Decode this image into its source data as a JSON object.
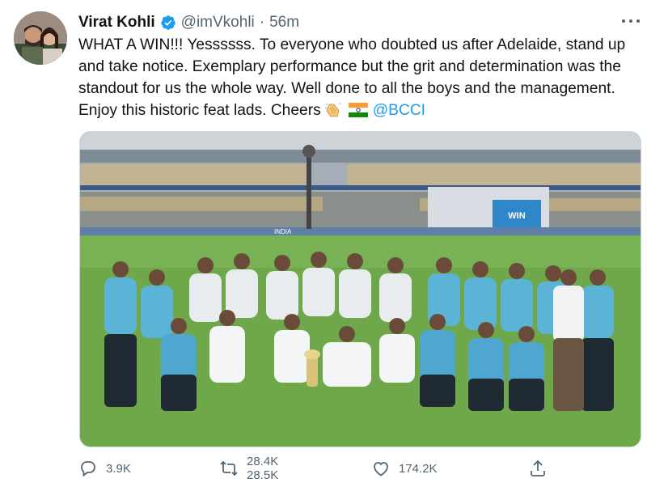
{
  "tweet": {
    "author_name": "Virat Kohli",
    "handle": "@imVkohli",
    "separator": "·",
    "time": "56m",
    "text_main": "WHAT A WIN!!! Yessssss. To everyone who doubted us after Adelaide, stand up and take notice. Exemplary performance but the grit and determination was the standout for us the whole way. Well done to all the boys and the management. Enjoy this historic feat lads. Cheers",
    "mention": "@BCCI",
    "emojis": [
      "clapping-hands",
      "india-flag"
    ]
  },
  "photo": {
    "board_text": "WIN",
    "boundary_text": "INDIA"
  },
  "actions": {
    "replies": "3.9K",
    "retweets": "28.4K",
    "retweets_next": "28.5K",
    "likes": "174.2K"
  },
  "colors": {
    "accent": "#1d9bf0",
    "muted": "#536471",
    "text": "#0f1419",
    "grass": "#6fa84b"
  }
}
